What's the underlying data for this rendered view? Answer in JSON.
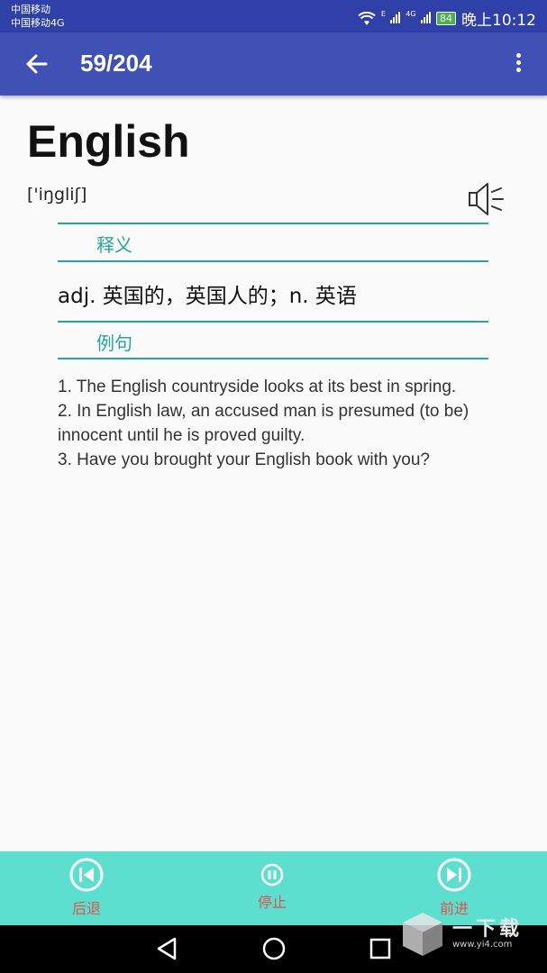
{
  "status_bar": {
    "carrier1": "中国移动",
    "carrier2": "中国移动4G",
    "signal1_tag": "E",
    "signal2_tag": "4G",
    "battery": "84",
    "time": "晚上10:12"
  },
  "app_bar": {
    "pager": "59/204"
  },
  "entry": {
    "word": "English",
    "phonetic": "['iŋgliʃ]",
    "definition_title": "释义",
    "definition": "adj. 英国的，英国人的；n. 英语",
    "examples_title": "例句",
    "examples": [
      "1. The English countryside looks at its best in spring.",
      "2. In English law, an accused man is presumed (to be) innocent until he is proved guilty.",
      "3. Have you brought your English book with you?"
    ]
  },
  "controls": {
    "prev_label": "后退",
    "pause_label": "停止",
    "next_label": "前进"
  },
  "watermark": {
    "text": "一下载",
    "url": "www.yi4.com"
  },
  "colors": {
    "status_bar": "#2f41a8",
    "app_bar": "#3f51b5",
    "accent": "#26a69a",
    "controls_bg": "#5ddfd0",
    "control_label": "#e0524c"
  }
}
